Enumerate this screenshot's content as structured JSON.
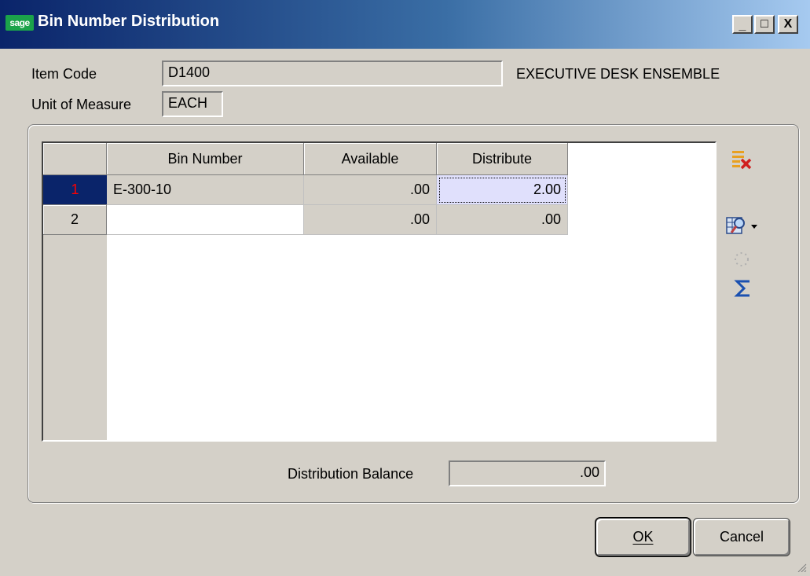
{
  "window": {
    "logo_text": "sage",
    "title": "Bin Number Distribution",
    "minimize_glyph": "_",
    "maximize_glyph": "□",
    "close_glyph": "X"
  },
  "header": {
    "item_code_label": "Item Code",
    "item_code_value": "D1400",
    "item_description": "EXECUTIVE DESK ENSEMBLE",
    "uom_label": "Unit of Measure",
    "uom_value": "EACH"
  },
  "grid": {
    "columns": [
      "Bin Number",
      "Available",
      "Distribute"
    ],
    "rows": [
      {
        "num": "1",
        "bin": "E-300-10",
        "available": ".00",
        "distribute": "2.00"
      },
      {
        "num": "2",
        "bin": "",
        "available": ".00",
        "distribute": ".00"
      }
    ]
  },
  "toolbar": {
    "delete_icon": "delete-line-icon",
    "lookup_icon": "lookup-icon",
    "spinner_icon": "busy-spinner-icon",
    "totals_icon": "sigma-icon"
  },
  "footer": {
    "balance_label": "Distribution Balance",
    "balance_value": ".00"
  },
  "buttons": {
    "ok_label": "OK",
    "cancel_label": "Cancel"
  },
  "colors": {
    "title_start": "#0a246a",
    "title_end": "#a6caf0",
    "selected_row_header": "#0a246a",
    "selected_row_number": "#ff0000",
    "active_cell": "#e0e0fc"
  }
}
